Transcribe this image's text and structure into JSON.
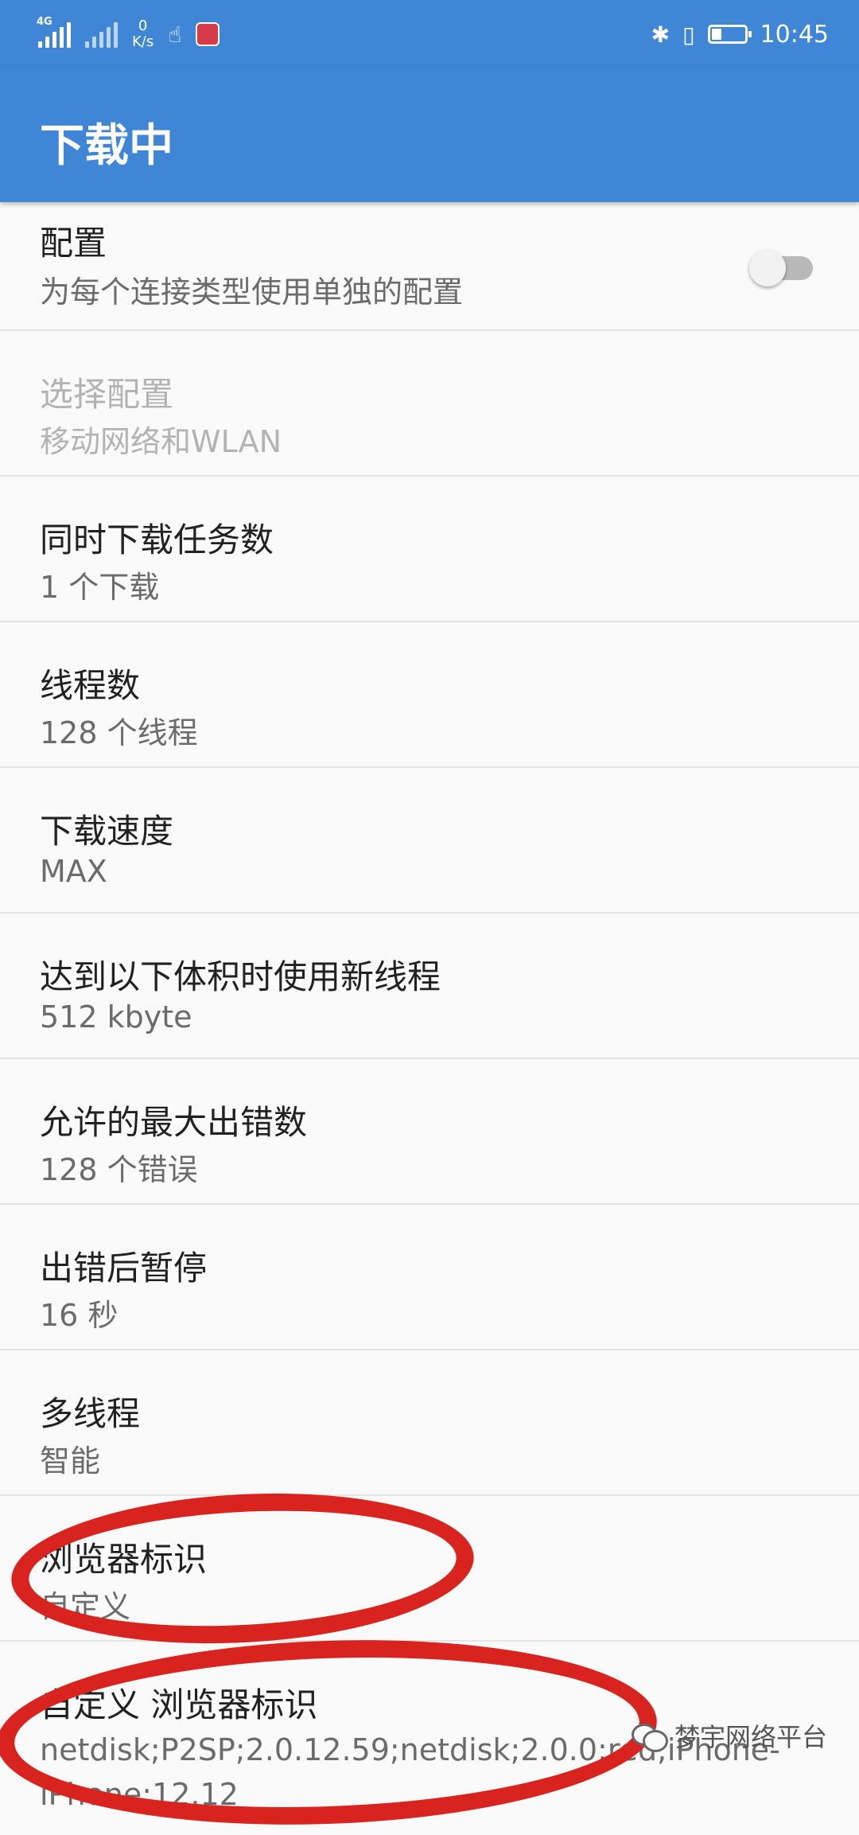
{
  "status_bar": {
    "network_type": "4G",
    "speed_value": "0",
    "speed_unit": "K/s",
    "time": "10:45",
    "battery_level": 0.3
  },
  "app_bar": {
    "title": "下载中"
  },
  "settings": [
    {
      "title": "配置",
      "summary": "为每个连接类型使用单独的配置",
      "toggle": false
    },
    {
      "title": "选择配置",
      "summary": "移动网络和WLAN",
      "disabled": true
    },
    {
      "title": "同时下载任务数",
      "summary": "1 个下载"
    },
    {
      "title": "线程数",
      "summary": "128 个线程"
    },
    {
      "title": "下载速度",
      "summary": "MAX"
    },
    {
      "title": "达到以下体积时使用新线程",
      "summary": "512 kbyte"
    },
    {
      "title": "允许的最大出错数",
      "summary": "128 个错误"
    },
    {
      "title": "出错后暂停",
      "summary": "16 秒"
    },
    {
      "title": "多线程",
      "summary": "智能"
    },
    {
      "title": "浏览器标识",
      "summary": "自定义"
    },
    {
      "title": "自定义 浏览器标识",
      "summary": "netdisk;P2SP;2.0.12.59;netdisk;2.0.0;red;iPhone-iPhone;12.12"
    }
  ],
  "watermark": {
    "text": "梦宇网络平台"
  },
  "colors": {
    "accent": "#3f86d6",
    "annotation": "#d8231e"
  }
}
